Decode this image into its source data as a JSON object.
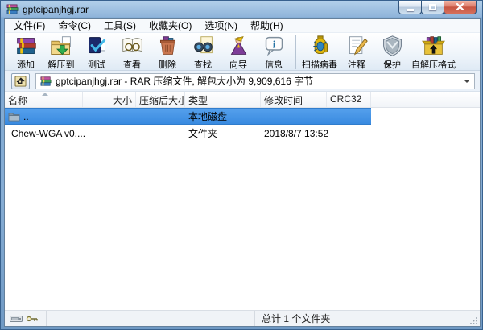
{
  "window": {
    "title": "gptcipanjhgj.rar",
    "app_icon": "winrar-books-icon"
  },
  "menu": {
    "items": [
      "文件(F)",
      "命令(C)",
      "工具(S)",
      "收藏夹(O)",
      "选项(N)",
      "帮助(H)"
    ]
  },
  "toolbar": {
    "items": [
      {
        "label": "添加",
        "icon": "add-archive-icon"
      },
      {
        "label": "解压到",
        "icon": "extract-to-icon"
      },
      {
        "label": "测试",
        "icon": "test-archive-icon"
      },
      {
        "label": "查看",
        "icon": "view-file-icon"
      },
      {
        "label": "删除",
        "icon": "delete-icon"
      },
      {
        "label": "查找",
        "icon": "find-icon"
      },
      {
        "label": "向导",
        "icon": "wizard-icon"
      },
      {
        "label": "信息",
        "icon": "info-icon"
      },
      {
        "label": "扫描病毒",
        "icon": "scan-virus-icon"
      },
      {
        "label": "注释",
        "icon": "comment-icon"
      },
      {
        "label": "保护",
        "icon": "protect-icon"
      },
      {
        "label": "自解压格式",
        "icon": "sfx-icon"
      }
    ]
  },
  "addressbar": {
    "archive_info": "gptcipanjhgj.rar - RAR 压缩文件, 解包大小为 9,909,616 字节",
    "up_button_icon": "folder-up-icon",
    "archive_icon": "winrar-books-icon"
  },
  "filelist": {
    "columns": [
      "名称",
      "大小",
      "压缩后大小",
      "类型",
      "修改时间",
      "CRC32"
    ],
    "sort": {
      "column": "名称",
      "direction": "asc"
    },
    "rows": [
      {
        "icon": "up-folder-icon",
        "name": "..",
        "size": "",
        "packed": "",
        "type": "本地磁盘",
        "modified": "",
        "crc32": "",
        "selected": true
      },
      {
        "icon": "folder-icon",
        "name": "Chew-WGA v0....",
        "size": "",
        "packed": "",
        "type": "文件夹",
        "modified": "2018/8/7 13:52",
        "crc32": "",
        "selected": false
      }
    ]
  },
  "statusbar": {
    "icons": [
      "drive-icon",
      "key-icon"
    ],
    "total_text": "总计 1 个文件夹"
  },
  "colors": {
    "titlebar_blue": "#8fb4da",
    "selection_blue": "#3f92e6",
    "close_button_red": "#c75542",
    "folder_yellow": "#f3d173",
    "toolbar_bg": "#e8f0f9"
  }
}
